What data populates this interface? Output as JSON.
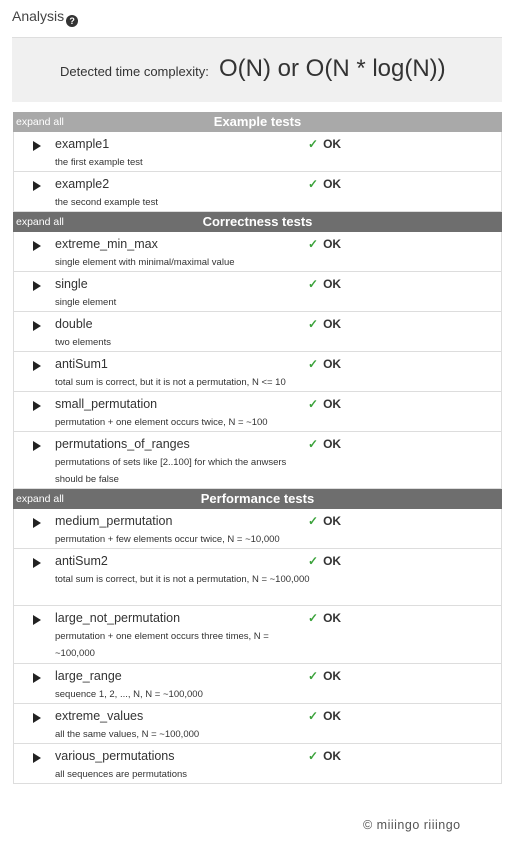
{
  "analysis": {
    "title": "Analysis",
    "help_icon": "?"
  },
  "complexity": {
    "label": "Detected time complexity:",
    "value": "O(N) or O(N * log(N))"
  },
  "check_glyph": "✓",
  "groups": [
    {
      "expand_label": "expand all",
      "title": "Example tests",
      "tests": [
        {
          "name": "example1",
          "desc": "the first example test",
          "result": "OK"
        },
        {
          "name": "example2",
          "desc": "the second example test",
          "result": "OK"
        }
      ]
    },
    {
      "expand_label": "expand all",
      "title": "Correctness tests",
      "tests": [
        {
          "name": "extreme_min_max",
          "desc": "single element with minimal/maximal value",
          "result": "OK"
        },
        {
          "name": "single",
          "desc": "single element",
          "result": "OK"
        },
        {
          "name": "double",
          "desc": "two elements",
          "result": "OK"
        },
        {
          "name": "antiSum1",
          "desc": "total sum is correct, but it is not a permutation, N <= 10",
          "result": "OK"
        },
        {
          "name": "small_permutation",
          "desc": "permutation + one element occurs twice, N = ~100",
          "result": "OK"
        },
        {
          "name": "permutations_of_ranges",
          "desc": "permutations of sets like [2..100] for which the anwsers should be false",
          "result": "OK"
        }
      ]
    },
    {
      "expand_label": "expand all",
      "title": "Performance tests",
      "tests": [
        {
          "name": "medium_permutation",
          "desc": "permutation + few elements occur twice, N = ~10,000",
          "result": "OK"
        },
        {
          "name": "antiSum2",
          "desc": "total sum is correct, but it is not a permutation, N = ~100,000",
          "result": "OK"
        },
        {
          "name": "large_not_permutation",
          "desc": "permutation + one element occurs three times, N = ~100,000",
          "result": "OK"
        },
        {
          "name": "large_range",
          "desc": "sequence 1, 2, ..., N, N = ~100,000",
          "result": "OK"
        },
        {
          "name": "extreme_values",
          "desc": "all the same values, N = ~100,000",
          "result": "OK"
        },
        {
          "name": "various_permutations",
          "desc": "all sequences are permutations",
          "result": "OK"
        }
      ]
    }
  ],
  "footer": {
    "logo_text": "© miiingo riiingo"
  }
}
